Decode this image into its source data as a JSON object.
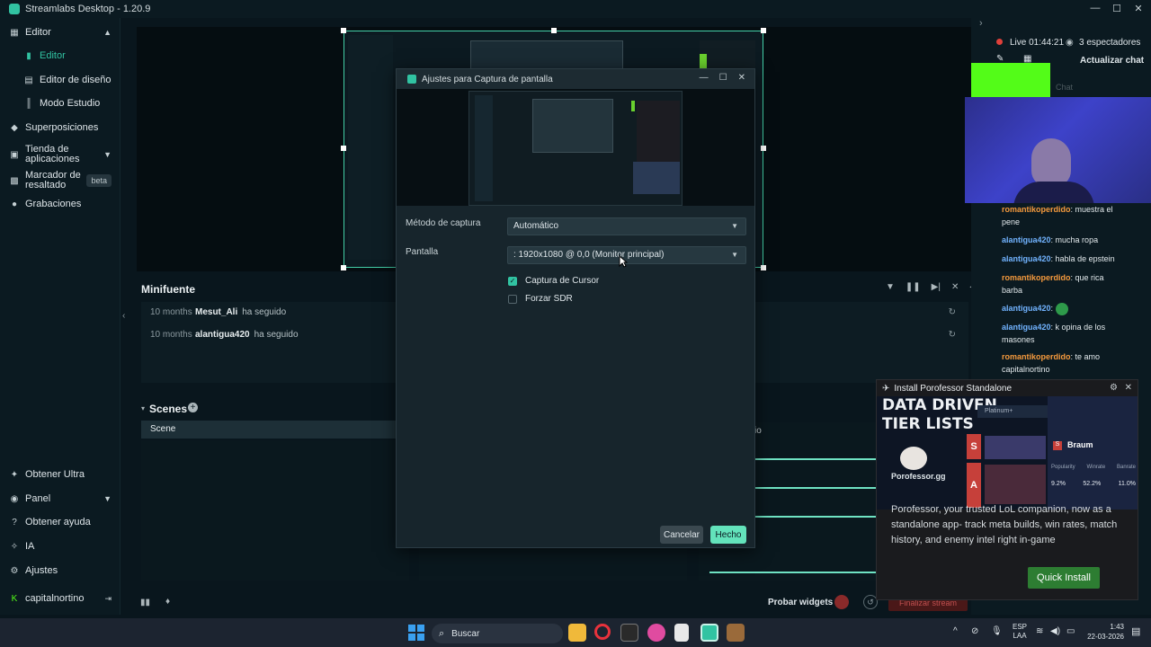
{
  "window": {
    "title": "Streamlabs Desktop - 1.20.9"
  },
  "sidebar": {
    "items": [
      {
        "label": "Editor"
      },
      {
        "label": "Editor"
      },
      {
        "label": "Editor de diseño"
      },
      {
        "label": "Modo Estudio"
      },
      {
        "label": "Superposiciones"
      },
      {
        "label": "Tienda de aplicaciones"
      },
      {
        "label": "Marcador de resaltado",
        "badge": "beta"
      },
      {
        "label": "Grabaciones"
      }
    ],
    "bottom_items": [
      {
        "label": "Obtener Ultra"
      },
      {
        "label": "Panel"
      },
      {
        "label": "Obtener ayuda"
      },
      {
        "label": "IA"
      },
      {
        "label": "Ajustes"
      },
      {
        "label": "capitalnortino"
      }
    ]
  },
  "minifuente": {
    "title": "Minifuente",
    "events": [
      {
        "ago": "10 months",
        "user": "Mesut_Ali",
        "action": "ha seguido"
      },
      {
        "ago": "10 months",
        "user": "alantigua420",
        "action": "ha seguido"
      }
    ]
  },
  "scenes": {
    "title": "Scenes",
    "items": [
      "Scene"
    ]
  },
  "mixer": {
    "partial_label": "io"
  },
  "bottombar": {
    "test_widgets": "Probar widgets",
    "end_stream": "Finalizar stream"
  },
  "dialog": {
    "title": "Ajustes para Captura de pantalla",
    "capture_method_label": "Método de captura",
    "capture_method_value": "Automático",
    "screen_label": "Pantalla",
    "screen_value": ": 1920x1080 @ 0,0 (Monitor principal)",
    "cursor_capture": {
      "label": "Captura de Cursor",
      "checked": true
    },
    "force_sdr": {
      "label": "Forzar SDR",
      "checked": false
    },
    "cancel": "Cancelar",
    "done": "Hecho"
  },
  "live": {
    "status": "Live 01:44:21",
    "viewers": "3 espectadores",
    "refresh_chat": "Actualizar chat",
    "chat_tab": "Chat"
  },
  "chat": [
    {
      "user": "romantikoperdido",
      "text": "muestra el pene",
      "color": "#f59a3d"
    },
    {
      "user": "alantigua420",
      "text": "mucha ropa",
      "color": "#71b3ff"
    },
    {
      "user": "alantigua420",
      "text": "habla de epstein",
      "color": "#71b3ff"
    },
    {
      "user": "romantikoperdido",
      "text": "que rica barba",
      "color": "#f59a3d"
    },
    {
      "user": "alantigua420",
      "text": "",
      "color": "#71b3ff"
    },
    {
      "user": "alantigua420",
      "text": "k opina de los masones",
      "color": "#71b3ff"
    },
    {
      "user": "romantikoperdido",
      "text": "te amo capitalnortino",
      "color": "#f59a3d"
    }
  ],
  "notification": {
    "title": "Install Porofessor Standalone",
    "ad_headline_1": "DATA DRIVEN",
    "ad_headline_2": "TIER LISTS",
    "ad_brand": "Porofessor.gg",
    "ad_champion": "Braum",
    "ad_stats": [
      {
        "label": "Popularity",
        "value": "9.2%"
      },
      {
        "label": "Winrate",
        "value": "52.2%"
      },
      {
        "label": "Banrate",
        "value": "11.0%"
      }
    ],
    "ad_tier_s": "S",
    "ad_tier_a": "A",
    "ad_filter": "Platinum+",
    "body": "Porofessor, your trusted LoL companion, now as a standalone app- track meta builds, win rates, match history, and enemy intel right in-game",
    "button": "Quick Install"
  },
  "taskbar": {
    "search_placeholder": "Buscar",
    "language": "ESP",
    "language_sub": "LAA",
    "time": "1:43",
    "date": "22-03-2026"
  },
  "colors": {
    "accent": "#31c3a2",
    "background": "#09161d",
    "live_red": "#e0403a",
    "install_green": "#2d7d32"
  }
}
